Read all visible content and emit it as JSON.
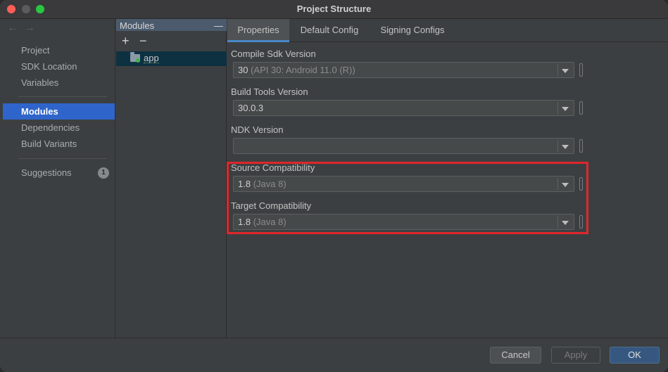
{
  "window": {
    "title": "Project Structure"
  },
  "nav": {
    "items": [
      {
        "label": "Project"
      },
      {
        "label": "SDK Location"
      },
      {
        "label": "Variables"
      },
      {
        "label": "Modules"
      },
      {
        "label": "Dependencies"
      },
      {
        "label": "Build Variants"
      },
      {
        "label": "Suggestions",
        "badge": "1"
      }
    ],
    "selected": "Modules"
  },
  "modules_panel": {
    "header": "Modules",
    "collapse_glyph": "—",
    "add_glyph": "+",
    "remove_glyph": "−",
    "items": [
      {
        "label": "app"
      }
    ]
  },
  "tabs": [
    {
      "label": "Properties"
    },
    {
      "label": "Default Config"
    },
    {
      "label": "Signing Configs"
    }
  ],
  "fields": [
    {
      "label": "Compile Sdk Version",
      "value": "30",
      "hint": "(API 30: Android 11.0 (R))"
    },
    {
      "label": "Build Tools Version",
      "value": "30.0.3",
      "hint": ""
    },
    {
      "label": "NDK Version",
      "value": "",
      "hint": ""
    },
    {
      "label": "Source Compatibility",
      "value": "1.8",
      "hint": "(Java 8)"
    },
    {
      "label": "Target Compatibility",
      "value": "1.8",
      "hint": "(Java 8)"
    }
  ],
  "footer": {
    "cancel_label": "Cancel",
    "apply_label": "Apply",
    "ok_label": "OK"
  },
  "colors": {
    "selection": "#2f65ca",
    "highlight_border": "#e0262b",
    "ok_button": "#365880"
  }
}
